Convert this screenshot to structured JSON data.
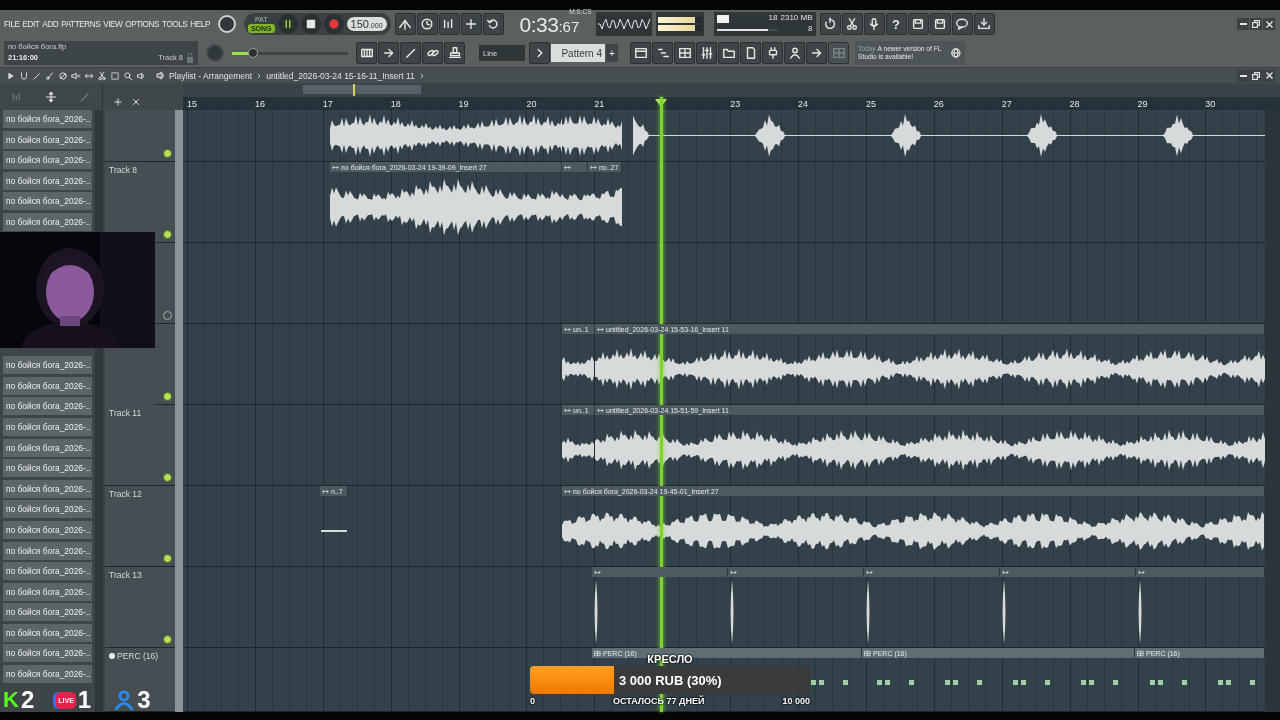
{
  "menu": [
    "FILE",
    "EDIT",
    "ADD",
    "PATTERNS",
    "VIEW",
    "OPTIONS",
    "TOOLS",
    "HELP"
  ],
  "hint_panel": {
    "file": "по бойся бога.flp",
    "time": "21:16:00",
    "target": "Track 8"
  },
  "transport": {
    "modes": [
      {
        "label": "PAT",
        "selected": false
      },
      {
        "label": "SONG",
        "selected": true
      }
    ],
    "playing": true
  },
  "tempo": {
    "value": "150",
    "fraction": ".000"
  },
  "master_volume": {
    "level": 0.18
  },
  "time": {
    "main": "0:33",
    "small": ":67",
    "unit": "M:S:CS"
  },
  "output_meter": {
    "level": 0.85
  },
  "cpu": {
    "level": 0.14,
    "reading": "18"
  },
  "memory": "2310 MB",
  "polyphony": {
    "level": 0.85,
    "reading": "8"
  },
  "help_button": "?",
  "snap": "Line",
  "pattern": {
    "name": "Pattern 4",
    "add": "+"
  },
  "news": {
    "date": "Today",
    "text": "A newer version of FL Studio is available!"
  },
  "browser": {
    "items_top": [
      "по бойся бога_2026-..",
      "по бойся бога_2026-..",
      "по бойся бога_2026-..",
      "по бойся бога_2026-..",
      "по бойся бога_2026-..",
      "по бойся бога_2026-.."
    ],
    "items_bottom": [
      "по бойся бога_2026-..",
      "по бойся бога_2026-..",
      "по бойся бога_2026-..",
      "по бойся бога_2026-..",
      "по бойся бога_2026-..",
      "по бойся бога_2026-..",
      "по бойся бога_2026-..",
      "по бойся бога_2026-..",
      "по бойся бога_2026-..",
      "по бойся бога_2026-..",
      "по бойся бога_2026-..",
      "по бойся бога_2026-..",
      "по бойся бога_2026-..",
      "по бойся бога_2026-..",
      "по бойся бога_2026-..",
      "по бойся бога_2026-.."
    ]
  },
  "playlist": {
    "title": "Playlist - Arrangement",
    "path": "untitled_2026-03-24 15-16-11_Insert 11",
    "ruler_before": [
      "15",
      "16",
      "17",
      "18",
      "19",
      "20",
      "21"
    ],
    "ruler_after": [
      "23",
      "24",
      "25",
      "26",
      "27",
      "28",
      "29",
      "30"
    ],
    "tracks": [
      {
        "on": true,
        "clips": [
          {
            "kind": "audio",
            "header": false
          },
          {
            "kind": "audio",
            "header": false
          },
          {
            "kind": "audio",
            "header": false
          }
        ]
      },
      {
        "name": "Track 8",
        "on": true,
        "clips": [
          {
            "kind": "audio",
            "label": "по бойся бога_2026-03-24 19-39-09_Insert 27"
          },
          {
            "kind": "audio"
          },
          {
            "kind": "audio",
            "label": "по..27"
          }
        ]
      },
      {
        "on": false
      },
      {
        "on": true,
        "clips": [
          {
            "kind": "audio",
            "label": "un..1"
          },
          {
            "kind": "audio",
            "label": "untitled_2026-03-24 15-53-16_Insert 11"
          }
        ]
      },
      {
        "name": "Track 11",
        "on": true,
        "clips": [
          {
            "kind": "audio",
            "label": "un..1"
          },
          {
            "kind": "audio",
            "label": "untitled_2026-03-24 15-51-59_Insert 11"
          }
        ]
      },
      {
        "name": "Track 12",
        "on": true,
        "clips": [
          {
            "kind": "audio",
            "label": "n..7"
          },
          {
            "kind": "audio",
            "label": "по бойся бога_2026-03-24 19-45-01_Insert 27"
          }
        ]
      },
      {
        "name": "Track 13",
        "on": true,
        "clips": [
          {
            "kind": "hit"
          },
          {
            "kind": "hit"
          },
          {
            "kind": "hit"
          },
          {
            "kind": "hit"
          },
          {
            "kind": "hit"
          }
        ]
      },
      {
        "name": "PERC (16)",
        "kind": "pattern",
        "clips": [
          {
            "kind": "pattern",
            "label": "PERC (16)"
          },
          {
            "kind": "pattern",
            "label": "PERC (16)"
          },
          {
            "kind": "pattern",
            "label": "PERC (16)"
          }
        ]
      }
    ]
  },
  "goal": {
    "title": "КРЕСЛО",
    "level": 0.3,
    "amount": "3 000 RUB (30%)",
    "min": "0",
    "remaining": "ОСТАЛОСЬ 77 ДНЕЙ",
    "max": "10 000"
  },
  "viewers": [
    {
      "kind": "kick",
      "logo": "K",
      "count": "2"
    },
    {
      "kind": "live",
      "logo": "LIVE",
      "count": "1"
    },
    {
      "kind": "person",
      "count": "3"
    }
  ]
}
